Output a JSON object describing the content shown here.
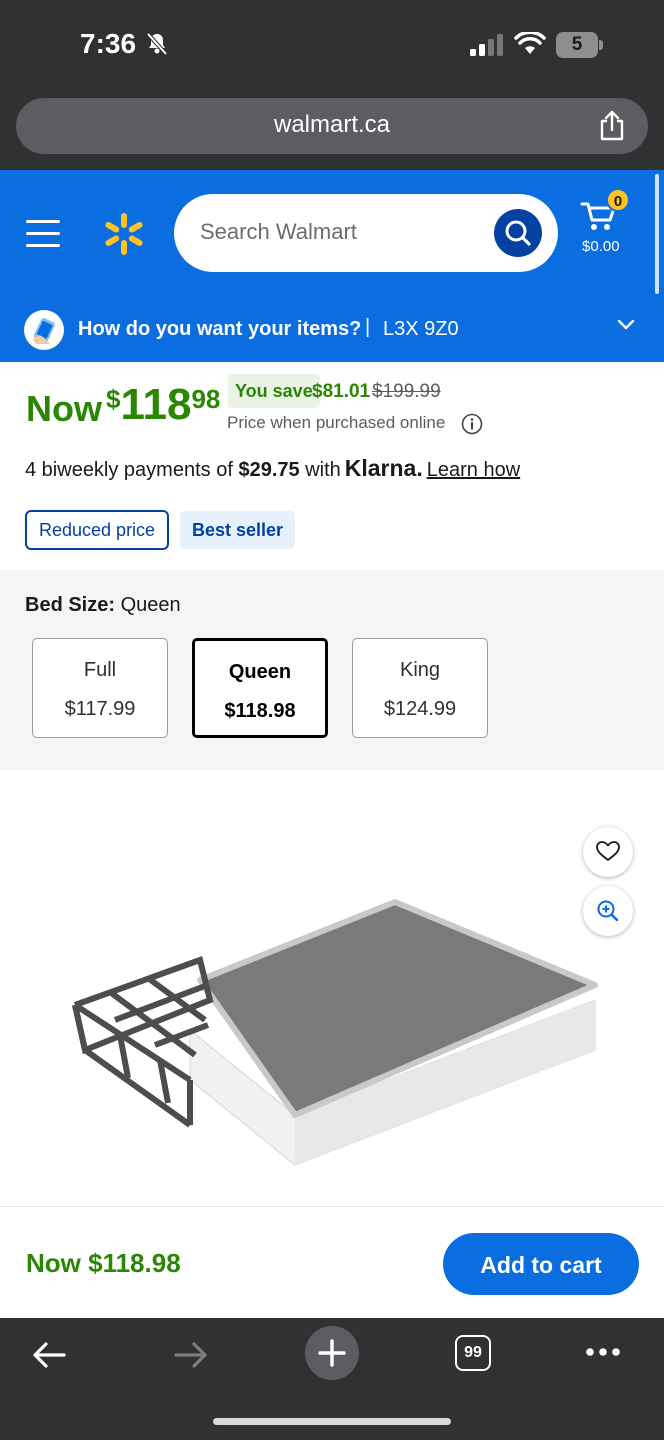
{
  "status_bar": {
    "time": "7:36",
    "battery": "5"
  },
  "browser": {
    "url": "walmart.ca",
    "tabs_count": "99"
  },
  "header": {
    "search_placeholder": "Search Walmart",
    "cart_count": "0",
    "cart_total": "$0.00",
    "delivery_question": "How do you want your items?",
    "separator": "|",
    "postal_code": "L3X 9Z0"
  },
  "price": {
    "now_label": "Now",
    "currency": "$",
    "dollars": "118",
    "cents": "98",
    "you_save_label": "You save",
    "save_amount": "$81.01",
    "was_price": "$199.99",
    "online_note": "Price when purchased online"
  },
  "klarna": {
    "prefix": "4 biweekly payments of",
    "amount": "$29.75",
    "with": "with",
    "brand": "Klarna.",
    "learn_how": "Learn how"
  },
  "tags": {
    "reduced": "Reduced price",
    "best_seller": "Best seller"
  },
  "size": {
    "label": "Bed Size:",
    "selected": "Queen",
    "options": [
      {
        "name": "Full",
        "price": "$117.99"
      },
      {
        "name": "Queen",
        "price": "$118.98"
      },
      {
        "name": "King",
        "price": "$124.99"
      }
    ]
  },
  "sticky": {
    "price": "Now $118.98",
    "add_to_cart": "Add to cart"
  },
  "colors": {
    "walmart_blue": "#0a6de0",
    "spark_yellow": "#ffc220",
    "price_green": "#2a8703",
    "dark_blue": "#0441a3"
  }
}
